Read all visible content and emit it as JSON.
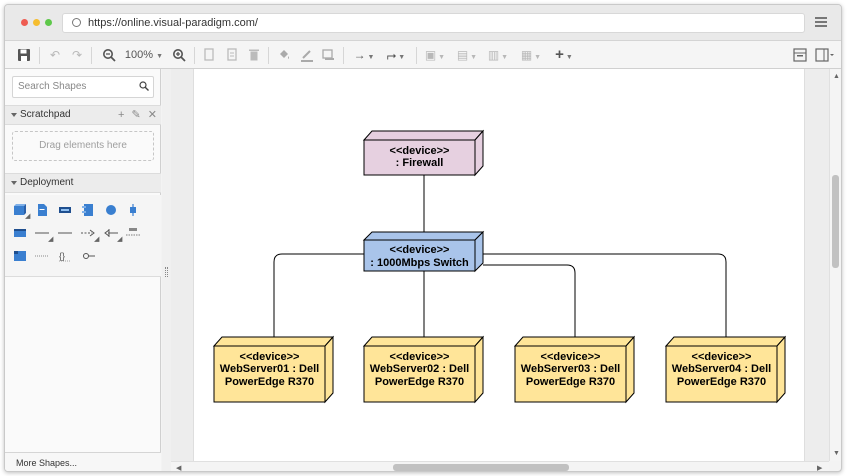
{
  "browser": {
    "url": "https://online.visual-paradigm.com/"
  },
  "toolbar": {
    "zoom_level": "100%"
  },
  "sidebar": {
    "search_placeholder": "Search Shapes",
    "scratchpad_label": "Scratchpad",
    "dropzone_text": "Drag elements here",
    "deployment_label": "Deployment",
    "more_shapes": "More Shapes..."
  },
  "diagram": {
    "colors": {
      "firewall": "#e6d0e0",
      "switch": "#a9c4ea",
      "server": "#ffe599"
    },
    "nodes": [
      {
        "id": "firewall",
        "stereotype": "<<device>>",
        "name": ": Firewall"
      },
      {
        "id": "switch",
        "stereotype": "<<device>>",
        "name": ": 1000Mbps Switch"
      },
      {
        "id": "server1",
        "stereotype": "<<device>>",
        "line1": "WebServer01 : Dell",
        "line2": "PowerEdge R370"
      },
      {
        "id": "server2",
        "stereotype": "<<device>>",
        "line1": "WebServer02 : Dell",
        "line2": "PowerEdge R370"
      },
      {
        "id": "server3",
        "stereotype": "<<device>>",
        "line1": "WebServer03 : Dell",
        "line2": "PowerEdge R370"
      },
      {
        "id": "server4",
        "stereotype": "<<device>>",
        "line1": "WebServer04 : Dell",
        "line2": "PowerEdge R370"
      }
    ]
  }
}
